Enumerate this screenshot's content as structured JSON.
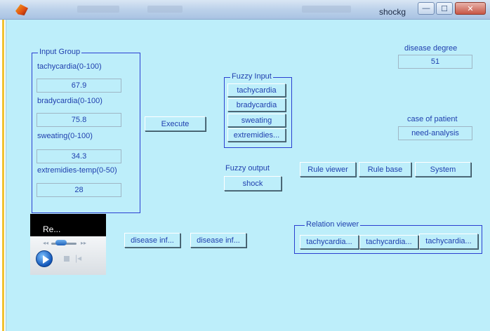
{
  "window": {
    "title": "shockg",
    "minimize_glyph": "—",
    "maximize_glyph": "☐",
    "close_glyph": "✕"
  },
  "input_group": {
    "title": "Input Group",
    "tachycardia_label": "tachycardia(0-100)",
    "tachycardia_value": "67.9",
    "bradycardia_label": "bradycardia(0-100)",
    "bradycardia_value": "75.8",
    "sweating_label": "sweating(0-100)",
    "sweating_value": "34.3",
    "extremities_label": "extremidies-temp(0-50)",
    "extremities_value": "28"
  },
  "execute_label": "Execute",
  "fuzzy_input": {
    "title": "Fuzzy Input",
    "buttons": [
      "tachycardia",
      "bradycardia",
      "sweating",
      "extremidies..."
    ]
  },
  "fuzzy_output": {
    "label": "Fuzzy output",
    "button": "shock"
  },
  "disease_degree": {
    "label": "disease degree",
    "value": "51"
  },
  "case_of_patient": {
    "label": "case of patient",
    "value": "need-analysis"
  },
  "tools": {
    "rule_viewer": "Rule viewer",
    "rule_base": "Rule base",
    "system": "System"
  },
  "relation_viewer": {
    "title": "Relation viewer",
    "buttons": [
      "tachycardia...",
      "tachycardia...",
      "tachycardia..."
    ]
  },
  "disease_info_buttons": [
    "disease inf...",
    "disease inf..."
  ],
  "media_player": {
    "title": "Re...",
    "seek_position": 0.45
  },
  "colors": {
    "background": "#bdeefa",
    "text": "#1f3fae",
    "panel_border": "#2a3fd1"
  }
}
